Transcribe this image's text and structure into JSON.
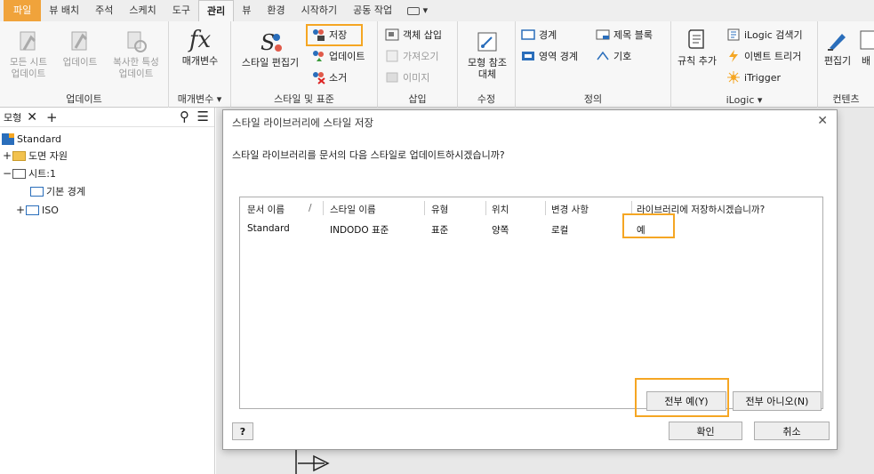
{
  "ribbon_tabs": [
    "파일",
    "뷰 배치",
    "주석",
    "스케치",
    "도구",
    "관리",
    "뷰",
    "환경",
    "시작하기",
    "공동 작업"
  ],
  "ribbon": {
    "update": {
      "sheet_update": "모든 시트\n업데이트",
      "update": "업데이트",
      "copy_props": "복사한 특성\n업데이트",
      "label": "업데이트"
    },
    "params": {
      "btn": "매개변수",
      "label": "매개변수 ▾",
      "fx": "fx"
    },
    "styles": {
      "editor": "스타일 편집기",
      "save": "저장",
      "update": "업데이트",
      "purge": "소거",
      "label": "스타일 및 표준"
    },
    "insert": {
      "object": "객체 삽입",
      "import": "가져오기",
      "image": "이미지",
      "label": "삽입"
    },
    "modify": {
      "replace": "모형 참조\n대체",
      "label": "수정"
    },
    "define": {
      "border": "경계",
      "title_block": "제목 블록",
      "zone_border": "영역 경계",
      "symbol": "기호",
      "label": "정의"
    },
    "rule": {
      "add_rule": "규칙 추가"
    },
    "ilogic": {
      "browser": "iLogic 검색기",
      "event": "이벤트 트리거",
      "itrigger": "iTrigger",
      "label": "iLogic ▾"
    },
    "content": {
      "editor": "편집기",
      "batch": "배",
      "label": "컨텐츠"
    }
  },
  "browser": {
    "tab": "모형",
    "items": [
      {
        "label": "Standard"
      },
      {
        "label": "도면 자원"
      },
      {
        "label": "시트:1"
      },
      {
        "label": "기본 경계"
      },
      {
        "label": "ISO"
      }
    ]
  },
  "dialog": {
    "title": "스타일 라이브러리에 스타일 저장",
    "question": "스타일 라이브러리를 문서의 다음 스타일로 업데이트하시겠습니까?",
    "columns": [
      "문서 이름",
      "스타일 이름",
      "유형",
      "위치",
      "변경 사항",
      "라이브러리에 저장하시겠습니까?"
    ],
    "sort_indicator": "/",
    "row": {
      "doc": "Standard",
      "style": "INDODO 표준",
      "type": "표준",
      "location": "양쪽",
      "change": "로컬",
      "save": "예"
    },
    "yes_all": "전부 예(Y)",
    "no_all": "전부 아니오(N)",
    "ok": "확인",
    "cancel": "취소",
    "help": "?"
  },
  "colors": {
    "file_tab": "#f0a33b",
    "highlight": "#f5a623",
    "accent_blue": "#2a6ebb"
  }
}
